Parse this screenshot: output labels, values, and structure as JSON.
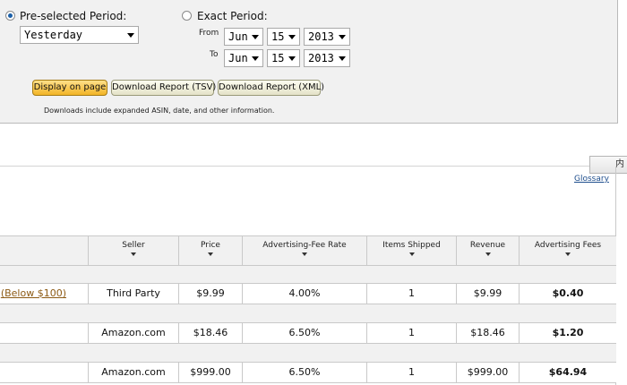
{
  "period": {
    "preselected_label": "Pre-selected Period:",
    "preselected_value": "Yesterday",
    "exact_label": "Exact Period:",
    "from_label": "From",
    "to_label": "To",
    "from": {
      "month": "Jun",
      "day": "15",
      "year": "2013"
    },
    "to": {
      "month": "Jun",
      "day": "15",
      "year": "2013"
    }
  },
  "buttons": {
    "display": "Display on page",
    "tsv": "Download Report (TSV)",
    "xml": "Download Report (XML)"
  },
  "downloads_note": "Downloads include expanded ASIN, date, and other information.",
  "side_tab_label": "内",
  "glossary_link": "Glossary",
  "table": {
    "headers": [
      "Seller",
      "Price",
      "Advertising-Fee Rate",
      "Items Shipped",
      "Revenue",
      "Advertising Fees"
    ],
    "rows": [
      {
        "category": "(Below $100)",
        "seller": "Third Party",
        "price": "$9.99",
        "rate": "4.00%",
        "items": "1",
        "revenue": "$9.99",
        "fees": "$0.40"
      },
      {
        "category": "",
        "seller": "Amazon.com",
        "price": "$18.46",
        "rate": "6.50%",
        "items": "1",
        "revenue": "$18.46",
        "fees": "$1.20"
      },
      {
        "category": "",
        "seller": "Amazon.com",
        "price": "$999.00",
        "rate": "6.50%",
        "items": "1",
        "revenue": "$999.00",
        "fees": "$64.94"
      }
    ]
  }
}
